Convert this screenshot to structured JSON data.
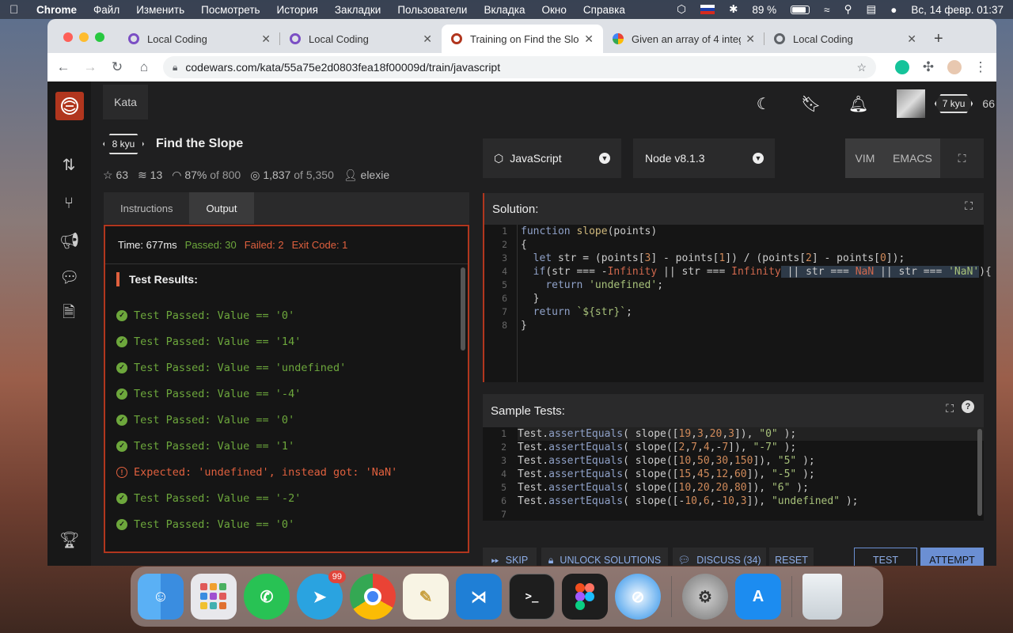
{
  "menubar": {
    "app": "Chrome",
    "items": [
      "Файл",
      "Изменить",
      "Посмотреть",
      "История",
      "Закладки",
      "Пользователи",
      "Вкладка",
      "Окно",
      "Справка"
    ],
    "battery": "89 %",
    "datetime": "Вс, 14 февр.  01:37"
  },
  "browser": {
    "tabs": [
      {
        "label": "Local Coding",
        "color": "#7b4fc4"
      },
      {
        "label": "Local Coding",
        "color": "#7b4fc4"
      },
      {
        "label": "Training on Find the Slop",
        "color": "#b1361e"
      },
      {
        "label": "Given an array of 4 integ",
        "color": "#4285f4"
      },
      {
        "label": "Local Coding",
        "color": "#5f6368"
      }
    ],
    "new_tab": "+",
    "url": "codewars.com/kata/55a75e2d0803fea18f00009d/train/javascript"
  },
  "codewars": {
    "nav_tab": "Kata",
    "user": {
      "rank": "7 kyu",
      "honor": "66"
    },
    "kata": {
      "rank": "8 kyu",
      "title": "Find the Slope",
      "stars": "63",
      "collections": "13",
      "satisfaction": "87%",
      "satisfaction_of": "of 800",
      "completed": "1,837",
      "completed_of": "of 5,350",
      "author": "elexie"
    },
    "left_tabs": [
      "Instructions",
      "Output"
    ],
    "output": {
      "time": "Time: 677ms",
      "passed": "Passed: 30",
      "failed": "Failed: 2",
      "exit_code": "Exit Code: 1",
      "results_title": "Test Results:",
      "rows": [
        {
          "status": "pass",
          "text": "Test Passed: Value == '0'"
        },
        {
          "status": "pass",
          "text": "Test Passed: Value == '14'"
        },
        {
          "status": "pass",
          "text": "Test Passed: Value == 'undefined'"
        },
        {
          "status": "pass",
          "text": "Test Passed: Value == '-4'"
        },
        {
          "status": "pass",
          "text": "Test Passed: Value == '0'"
        },
        {
          "status": "pass",
          "text": "Test Passed: Value == '1'"
        },
        {
          "status": "fail",
          "text": "Expected: 'undefined', instead got: 'NaN'"
        },
        {
          "status": "pass",
          "text": "Test Passed: Value == '-2'"
        },
        {
          "status": "pass",
          "text": "Test Passed: Value == '0'"
        }
      ]
    },
    "language": "JavaScript",
    "runtime": "Node v8.1.3",
    "modes": [
      "VIM",
      "EMACS"
    ],
    "solution_title": "Solution:",
    "sample_title": "Sample Tests:",
    "solution_line_numbers": [
      "1",
      "2",
      "3",
      "4",
      "5",
      "6",
      "7",
      "8"
    ],
    "sample_line_numbers": [
      "1",
      "2",
      "3",
      "4",
      "5",
      "6",
      "7"
    ],
    "buttons": {
      "skip": "SKIP",
      "unlock": "UNLOCK SOLUTIONS",
      "discuss": "DISCUSS (34)",
      "reset": "RESET",
      "test": "TEST",
      "attempt": "ATTEMPT"
    }
  },
  "dock": {
    "telegram_badge": "99"
  }
}
